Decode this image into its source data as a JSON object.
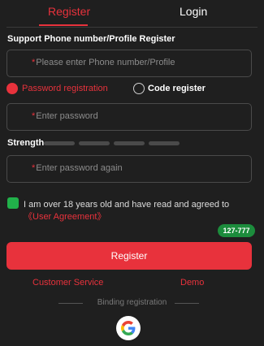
{
  "tabs": {
    "register": "Register",
    "login": "Login"
  },
  "section_label": "Support Phone number/Profile Register",
  "phone_field": {
    "star": "*",
    "placeholder": "Please enter Phone number/Profile"
  },
  "radios": {
    "password_registration": "Password registration",
    "code_register": "Code register"
  },
  "password_field": {
    "star": "*",
    "placeholder": "Enter password"
  },
  "strength": {
    "label": "Strength",
    "bars": 4,
    "level": 0
  },
  "password_again_field": {
    "star": "*",
    "placeholder": "Enter password again"
  },
  "agreement": {
    "text": "I am over 18 years old and have read and agreed to ",
    "link": "《User Agreement》",
    "checked": true
  },
  "badge": "127-777",
  "register_button": "Register",
  "links": {
    "customer_service": "Customer Service",
    "demo": "Demo"
  },
  "binding_label": "Binding registration",
  "icons": [
    "google-icon"
  ],
  "colors": {
    "accent": "#e8323c",
    "check": "#21b14a",
    "background": "#1f1f1f"
  }
}
